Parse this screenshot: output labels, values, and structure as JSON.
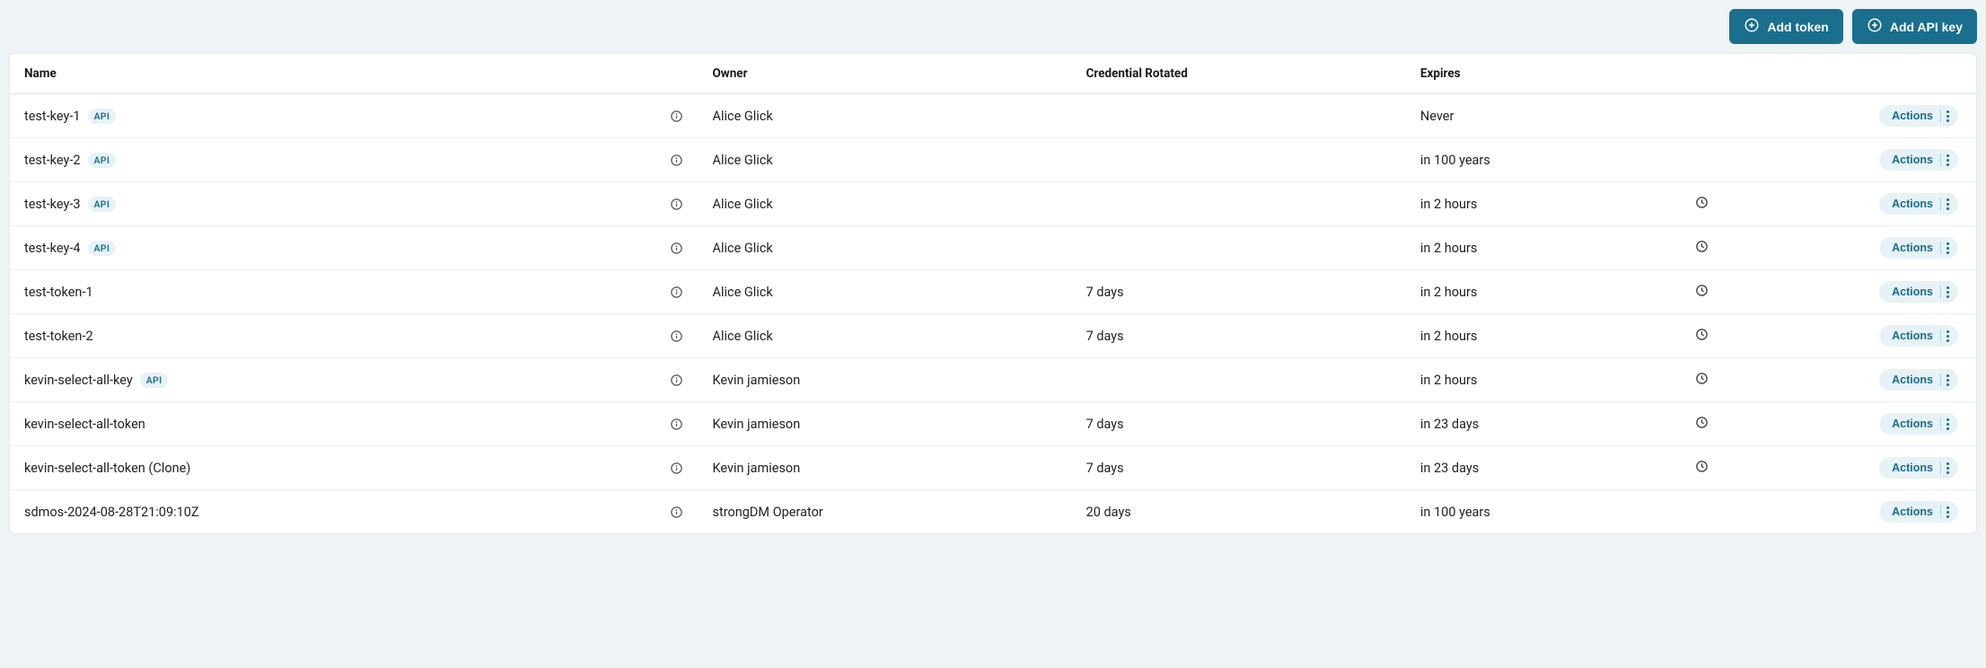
{
  "header": {
    "add_token_label": "Add token",
    "add_api_key_label": "Add API key"
  },
  "columns": {
    "name": "Name",
    "owner": "Owner",
    "rotated": "Credential Rotated",
    "expires": "Expires"
  },
  "badges": {
    "api": "API"
  },
  "actions_label": "Actions",
  "rows": [
    {
      "name": "test-key-1",
      "api": true,
      "owner": "Alice Glick",
      "rotated": "",
      "expires": "Never",
      "clock": false
    },
    {
      "name": "test-key-2",
      "api": true,
      "owner": "Alice Glick",
      "rotated": "",
      "expires": "in 100 years",
      "clock": false
    },
    {
      "name": "test-key-3",
      "api": true,
      "owner": "Alice Glick",
      "rotated": "",
      "expires": "in 2 hours",
      "clock": true
    },
    {
      "name": "test-key-4",
      "api": true,
      "owner": "Alice Glick",
      "rotated": "",
      "expires": "in 2 hours",
      "clock": true
    },
    {
      "name": "test-token-1",
      "api": false,
      "owner": "Alice Glick",
      "rotated": "7 days",
      "expires": "in 2 hours",
      "clock": true
    },
    {
      "name": "test-token-2",
      "api": false,
      "owner": "Alice Glick",
      "rotated": "7 days",
      "expires": "in 2 hours",
      "clock": true
    },
    {
      "name": "kevin-select-all-key",
      "api": true,
      "owner": "Kevin jamieson",
      "rotated": "",
      "expires": "in 2 hours",
      "clock": true
    },
    {
      "name": "kevin-select-all-token",
      "api": false,
      "owner": "Kevin jamieson",
      "rotated": "7 days",
      "expires": "in 23 days",
      "clock": true
    },
    {
      "name": "kevin-select-all-token (Clone)",
      "api": false,
      "owner": "Kevin jamieson",
      "rotated": "7 days",
      "expires": "in 23 days",
      "clock": true
    },
    {
      "name": "sdmos-2024-08-28T21:09:10Z",
      "api": false,
      "owner": "strongDM Operator",
      "rotated": "20 days",
      "expires": "in 100 years",
      "clock": false
    }
  ]
}
